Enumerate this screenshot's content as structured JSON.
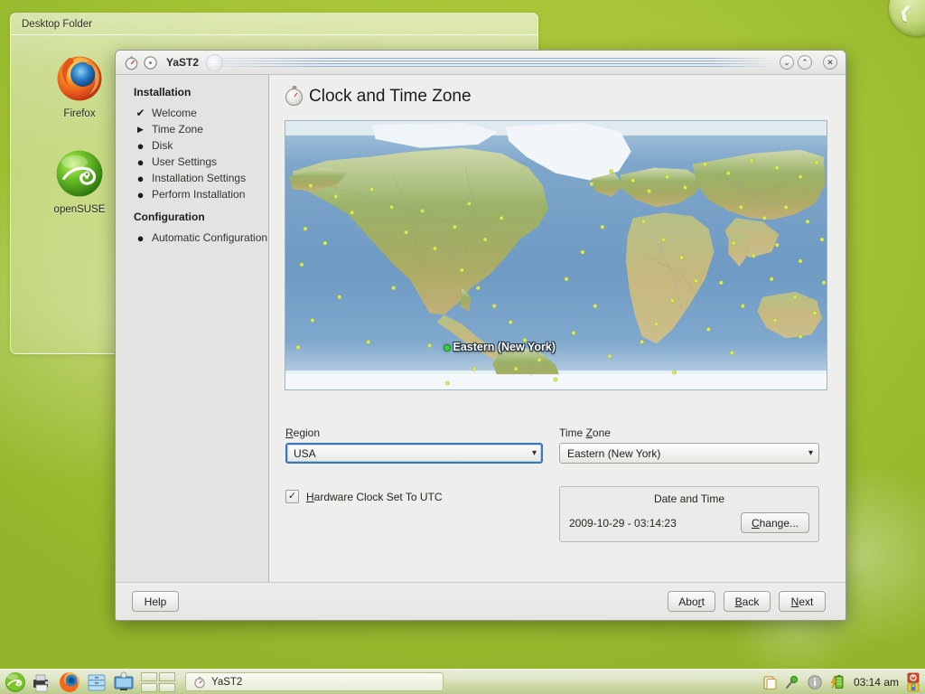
{
  "desktop": {
    "folder_widget": {
      "title": "Desktop Folder",
      "icons": [
        {
          "label": "Firefox",
          "icon": "firefox-icon"
        },
        {
          "label": "openSUSE",
          "icon": "opensuse-icon"
        }
      ]
    },
    "background_color": "#a8c838"
  },
  "window": {
    "title": "YaST2",
    "titlebar_icons": [
      "clock-icon",
      "circle-icon"
    ],
    "controls": {
      "minimize": "⌄",
      "maximize": "⌃",
      "close": "✕"
    }
  },
  "sidebar": {
    "heading_installation": "Installation",
    "heading_configuration": "Configuration",
    "installation_steps": [
      {
        "label": "Welcome",
        "marker": "✔",
        "state": "done"
      },
      {
        "label": "Time Zone",
        "marker": "▶",
        "state": "current"
      },
      {
        "label": "Disk",
        "marker": "●",
        "state": "pending"
      },
      {
        "label": "User Settings",
        "marker": "●",
        "state": "pending"
      },
      {
        "label": "Installation Settings",
        "marker": "●",
        "state": "pending"
      },
      {
        "label": "Perform Installation",
        "marker": "●",
        "state": "pending"
      }
    ],
    "configuration_steps": [
      {
        "label": "Automatic Configuration",
        "marker": "●",
        "state": "pending"
      }
    ]
  },
  "page": {
    "title": "Clock and Time Zone",
    "icon": "clock-icon"
  },
  "map": {
    "selected_label": "Eastern (New York)",
    "marker_color": "#35d435"
  },
  "form": {
    "region": {
      "label": "Region",
      "accel": "R",
      "value": "USA",
      "focused": true
    },
    "timezone": {
      "label": "Time Zone",
      "accel": "Z",
      "value": "Eastern (New York)",
      "focused": false
    },
    "hardware_clock": {
      "label": "Hardware Clock Set To UTC",
      "accel": "H",
      "checked": true,
      "check_glyph": "✓"
    },
    "date_time": {
      "group_title": "Date and Time",
      "value": "2009-10-29 - 03:14:23",
      "change_button": "Change...",
      "change_accel": "C"
    }
  },
  "footer": {
    "help": "Help",
    "abort": "Abort",
    "back": "Back",
    "next": "Next"
  },
  "taskbar": {
    "launchers": [
      "opensuse-menu-icon",
      "printer-icon",
      "firefox-icon",
      "file-manager-icon",
      "display-settings-icon"
    ],
    "pager_pages": 4,
    "task_button": {
      "label": "YaST2",
      "icon": "clock-icon"
    },
    "tray_icons": [
      "clipboard-icon",
      "pin-icon",
      "info-icon",
      "battery-icon"
    ],
    "clock": "03:14 am",
    "session_icons": [
      "power-icon",
      "lock-icon"
    ]
  }
}
